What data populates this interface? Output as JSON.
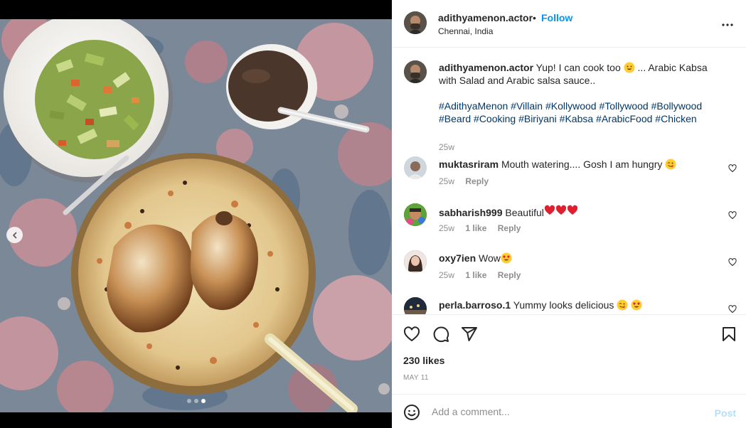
{
  "header": {
    "username": "adithyamenon.actor",
    "separator": "•",
    "follow_label": "Follow",
    "location": "Chennai, India",
    "more_icon": "more-horizontal-icon"
  },
  "media": {
    "carousel_index": 3,
    "carousel_count": 3,
    "prev_icon": "chevron-left-icon"
  },
  "caption": {
    "username": "adithyamenon.actor",
    "text_before_emoji": "Yup! I can cook too",
    "emoji": "grinning-sweat-face",
    "text_after_emoji": "... Arabic Kabsa with Salad and Arabic salsa sauce..",
    "hashtags": "#AdithyaMenon #Villain #Kollywood #Tollywood #Bollywood #Beard #Cooking #Biriyani #Kabsa #ArabicFood #Chicken",
    "time": "25w"
  },
  "comments": [
    {
      "username": "muktasriram",
      "text": "Mouth watering.... Gosh I am hungry",
      "emoji": "yum-face",
      "time": "25w",
      "likes": "",
      "reply_label": "Reply"
    },
    {
      "username": "sabharish999",
      "text": "Beautiful",
      "emoji": "red-heart x3",
      "time": "25w",
      "likes": "1 like",
      "reply_label": "Reply"
    },
    {
      "username": "oxy7ien",
      "text": "Wow",
      "emoji": "heart-eyes-face",
      "time": "25w",
      "likes": "1 like",
      "reply_label": "Reply"
    },
    {
      "username": "perla.barroso.1",
      "text": "Yummy looks delicious",
      "emoji": "yum-face heart-eyes-face",
      "time": "",
      "likes": "",
      "reply_label": ""
    }
  ],
  "actions": {
    "like_icon": "heart-icon",
    "comment_icon": "comment-bubble-icon",
    "share_icon": "paper-plane-icon",
    "save_icon": "bookmark-icon",
    "likes_text": "230 likes",
    "date_text": "MAY 11"
  },
  "composer": {
    "emoji_icon": "smiley-icon",
    "placeholder": "Add a comment...",
    "value": "",
    "post_label": "Post"
  },
  "colors": {
    "accent": "#0095f6",
    "hashtag": "#00376b",
    "muted": "#8e8e8e",
    "post_disabled": "#b2dffc"
  }
}
